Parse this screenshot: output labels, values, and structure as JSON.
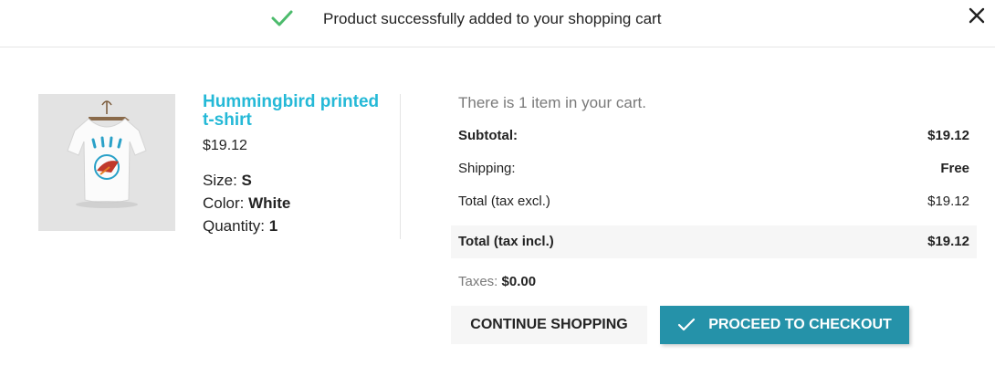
{
  "header": {
    "message": "Product successfully added to your shopping cart"
  },
  "product": {
    "name": "Hummingbird printed t-shirt",
    "price": "$19.12",
    "size_label": "Size:",
    "size_value": "S",
    "color_label": "Color:",
    "color_value": "White",
    "quantity_label": "Quantity:",
    "quantity_value": "1"
  },
  "cart": {
    "count_text": "There is 1 item in your cart.",
    "subtotal_label": "Subtotal:",
    "subtotal_value": "$19.12",
    "shipping_label": "Shipping:",
    "shipping_value": "Free",
    "total_excl_label": "Total (tax excl.)",
    "total_excl_value": "$19.12",
    "total_incl_label": "Total (tax incl.)",
    "total_incl_value": "$19.12",
    "taxes_label": "Taxes:",
    "taxes_value": "$0.00"
  },
  "buttons": {
    "continue": "Continue shopping",
    "checkout": "Proceed to checkout"
  },
  "icons": {
    "success": "check-icon",
    "close": "close-icon",
    "checkout": "check-icon"
  },
  "colors": {
    "accent": "#25b9d7",
    "checkout_bg": "#2592a9",
    "success": "#4cbb6c",
    "panel_bg": "#f6f6f6"
  }
}
